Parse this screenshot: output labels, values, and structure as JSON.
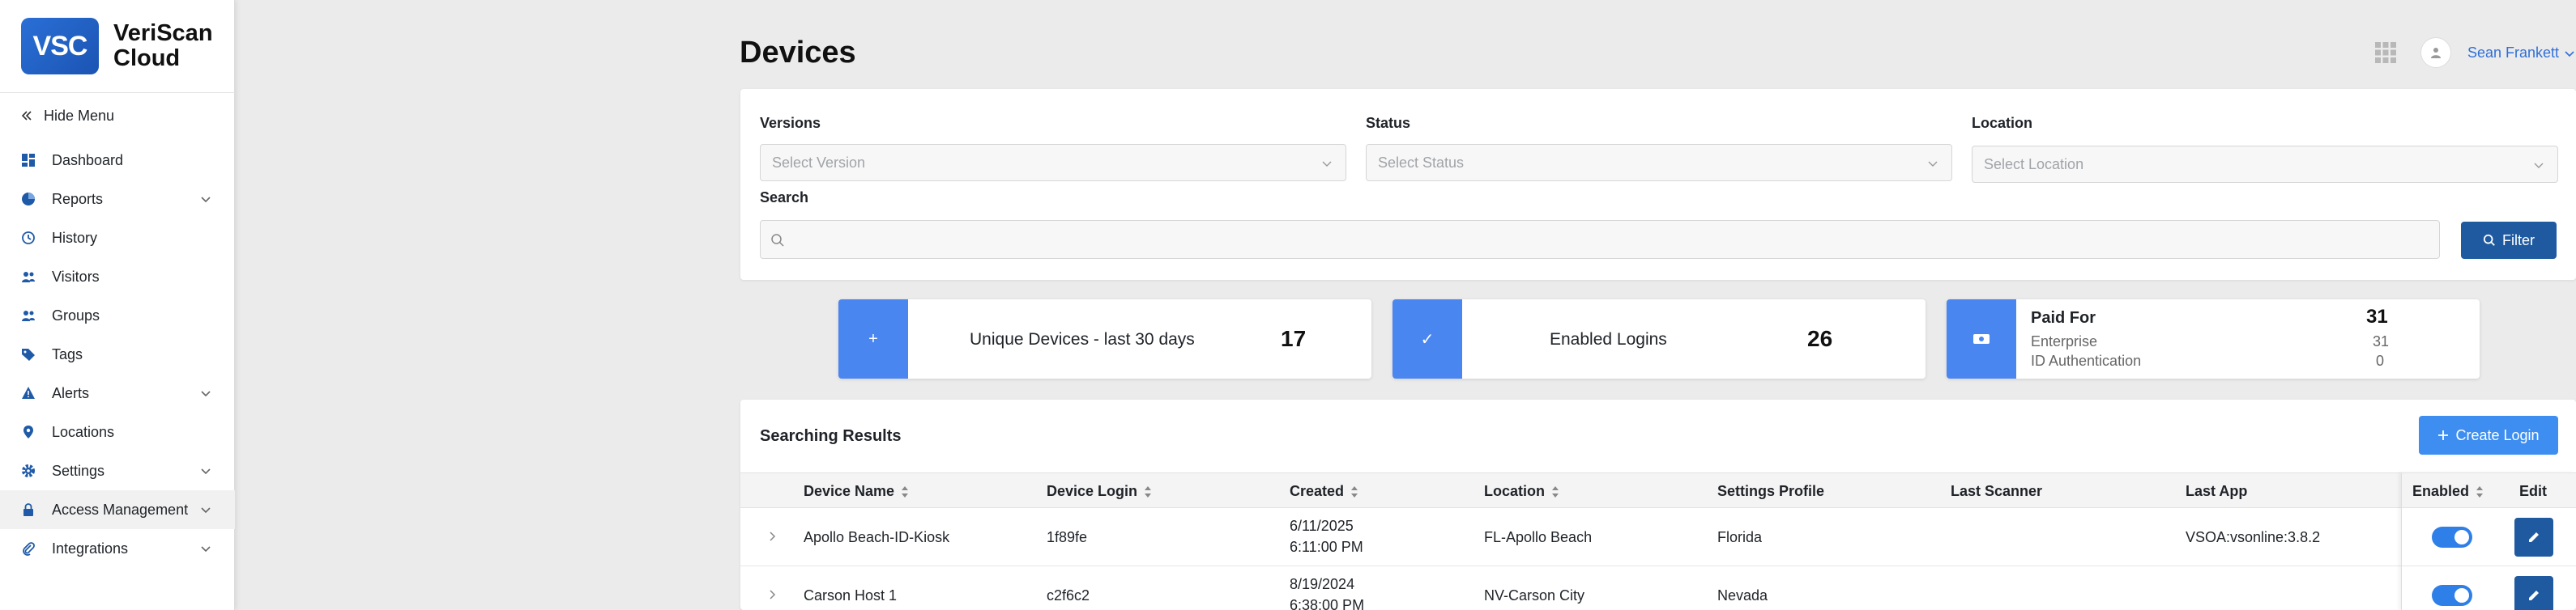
{
  "brand": {
    "logo_text": "VSC",
    "name_line1": "VeriScan",
    "name_line2": "Cloud"
  },
  "sidebar": {
    "hide_menu": "Hide Menu",
    "items": [
      {
        "label": "Dashboard",
        "icon": "dashboard-icon",
        "has_children": false
      },
      {
        "label": "Reports",
        "icon": "pie-chart-icon",
        "has_children": true
      },
      {
        "label": "History",
        "icon": "history-icon",
        "has_children": false
      },
      {
        "label": "Visitors",
        "icon": "users-icon",
        "has_children": false
      },
      {
        "label": "Groups",
        "icon": "users-icon",
        "has_children": false
      },
      {
        "label": "Tags",
        "icon": "tag-icon",
        "has_children": false
      },
      {
        "label": "Alerts",
        "icon": "warning-icon",
        "has_children": true
      },
      {
        "label": "Locations",
        "icon": "location-pin-icon",
        "has_children": false
      },
      {
        "label": "Settings",
        "icon": "gear-icon",
        "has_children": true
      },
      {
        "label": "Access Management",
        "icon": "lock-icon",
        "has_children": true
      },
      {
        "label": "Integrations",
        "icon": "paperclip-icon",
        "has_children": true
      }
    ]
  },
  "header": {
    "title": "Devices",
    "user_name": "Sean Frankett"
  },
  "filters": {
    "versions_label": "Versions",
    "versions_placeholder": "Select Version",
    "status_label": "Status",
    "status_placeholder": "Select Status",
    "location_label": "Location",
    "location_placeholder": "Select Location",
    "search_label": "Search",
    "search_value": "",
    "filter_button": "Filter"
  },
  "stats": {
    "unique_devices": {
      "label": "Unique Devices - last 30 days",
      "value": "17",
      "icon": "+"
    },
    "enabled_logins": {
      "label": "Enabled Logins",
      "value": "26",
      "icon": "✓"
    },
    "paid_for": {
      "label": "Paid For",
      "value": "31",
      "sub1_label": "Enterprise",
      "sub1_value": "31",
      "sub2_label": "ID Authentication",
      "sub2_value": "0"
    }
  },
  "results": {
    "title": "Searching Results",
    "create_button": "Create Login",
    "columns": {
      "device_name": "Device Name",
      "device_login": "Device Login",
      "created": "Created",
      "location": "Location",
      "settings_profile": "Settings Profile",
      "last_scanner": "Last Scanner",
      "last_app": "Last App",
      "enabled": "Enabled",
      "edit": "Edit"
    },
    "rows": [
      {
        "device_name": "Apollo Beach-ID-Kiosk",
        "device_login": "1f89fe",
        "created_date": "6/11/2025",
        "created_time": "6:11:00 PM",
        "location": "FL-Apollo Beach",
        "settings_profile": "Florida",
        "last_scanner": "",
        "last_app": "VSOA:vsonline:3.8.2",
        "enabled": true
      },
      {
        "device_name": "Carson Host 1",
        "device_login": "c2f6c2",
        "created_date": "8/19/2024",
        "created_time": "6:38:00 PM",
        "location": "NV-Carson City",
        "settings_profile": "Nevada",
        "last_scanner": "",
        "last_app": "",
        "enabled": true
      }
    ]
  },
  "colors": {
    "brand_blue": "#1f5aa0",
    "accent_blue": "#4a86f0",
    "toggle_on": "#2f7fe8"
  }
}
